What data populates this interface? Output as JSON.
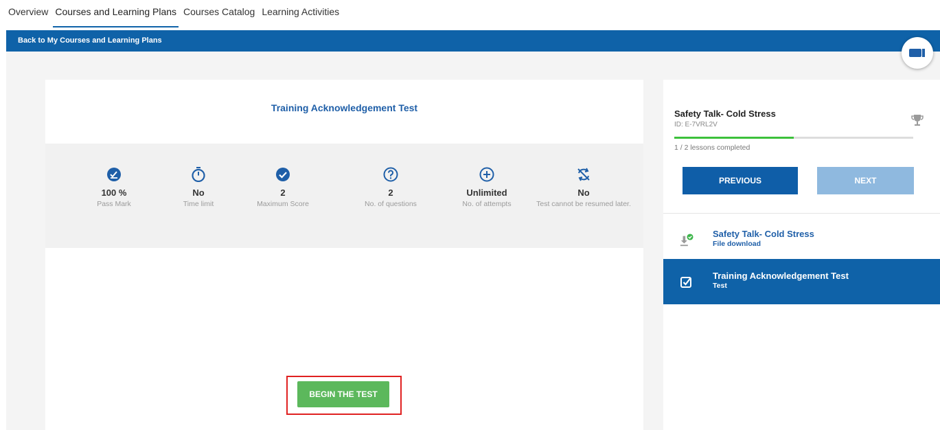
{
  "nav": {
    "tabs": [
      {
        "label": "Overview"
      },
      {
        "label": "Courses and Learning Plans"
      },
      {
        "label": "Courses Catalog"
      },
      {
        "label": "Learning Activities"
      }
    ]
  },
  "bar": {
    "back_label": "Back to My Courses and Learning Plans"
  },
  "test": {
    "title": "Training Acknowledgement Test",
    "info": [
      {
        "icon": "pass-mark-icon",
        "value": "100 %",
        "label": "Pass Mark"
      },
      {
        "icon": "stopwatch-icon",
        "value": "No",
        "label": "Time limit"
      },
      {
        "icon": "check-circle-icon",
        "value": "2",
        "label": "Maximum Score"
      },
      {
        "icon": "question-circle-icon",
        "value": "2",
        "label": "No. of questions"
      },
      {
        "icon": "plus-circle-icon",
        "value": "Unlimited",
        "label": "No. of attempts"
      },
      {
        "icon": "no-resume-icon",
        "value": "No",
        "label": "Test cannot be resumed later."
      }
    ],
    "begin_label": "BEGIN THE TEST"
  },
  "course": {
    "name": "Safety Talk- Cold Stress",
    "id_text": "ID: E-7VRL2V",
    "progress_fraction": 0.5,
    "progress_text": "1 / 2 lessons completed",
    "prev_label": "PREVIOUS",
    "next_label": "NEXT",
    "lessons": [
      {
        "name": "Safety Talk- Cold Stress",
        "type": "File download",
        "icon": "download-icon"
      },
      {
        "name": "Training Acknowledgement Test",
        "type": "Test",
        "icon": "checkbox-icon"
      }
    ]
  },
  "colors": {
    "primary": "#0f62a8",
    "success": "#5cb85c",
    "progress": "#3cc13b",
    "highlight_box": "#e02020"
  }
}
